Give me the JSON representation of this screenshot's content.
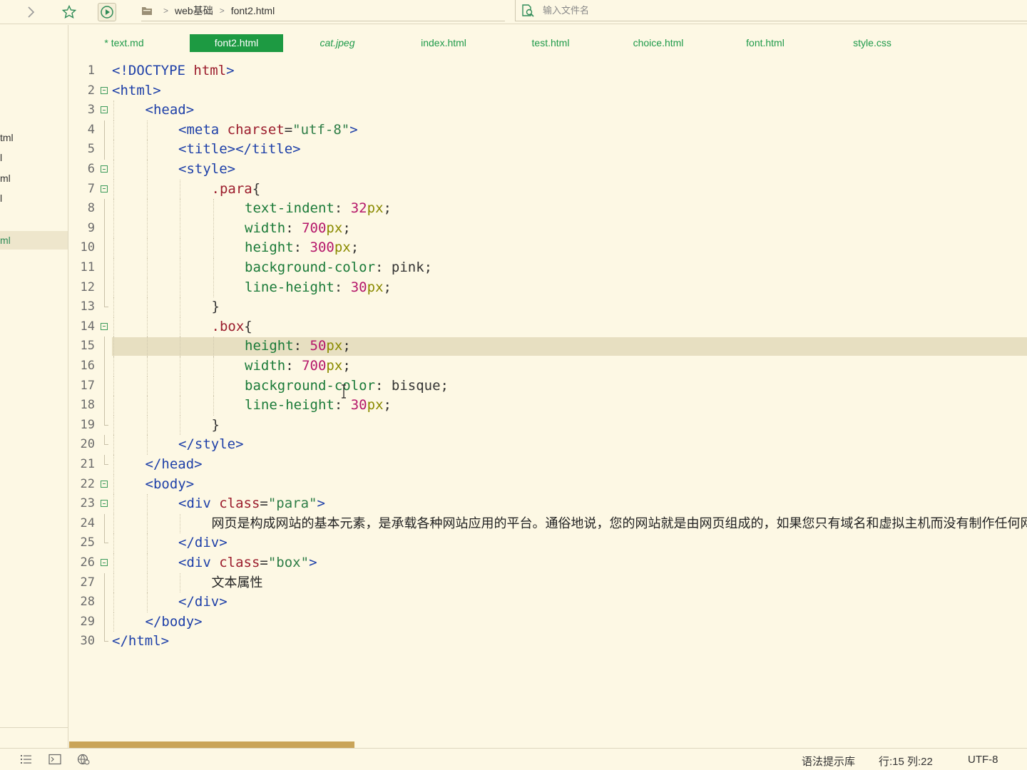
{
  "toolbar": {
    "breadcrumb": [
      "web基础",
      "font2.html"
    ],
    "search_placeholder": "输入文件名"
  },
  "sidebar": {
    "items": [
      {
        "label": "tml",
        "active": false
      },
      {
        "label": "l",
        "active": false
      },
      {
        "label": "ml",
        "active": false
      },
      {
        "label": "l",
        "active": false
      },
      {
        "label": "ml",
        "active": true
      }
    ]
  },
  "tabs": [
    {
      "label": "* text.md",
      "active": false,
      "italic": false
    },
    {
      "label": "font2.html",
      "active": true,
      "italic": false
    },
    {
      "label": "cat.jpeg",
      "active": false,
      "italic": true
    },
    {
      "label": "index.html",
      "active": false,
      "italic": false
    },
    {
      "label": "test.html",
      "active": false,
      "italic": false
    },
    {
      "label": "choice.html",
      "active": false,
      "italic": false
    },
    {
      "label": "font.html",
      "active": false,
      "italic": false
    },
    {
      "label": "style.css",
      "active": false,
      "italic": false
    }
  ],
  "editor": {
    "current_line": 15,
    "lines": [
      {
        "n": "1",
        "fold": "",
        "indent": 0,
        "tokens": [
          [
            "tag",
            "<!DOCTYPE "
          ],
          [
            "attr",
            "html"
          ],
          [
            "tag",
            ">"
          ]
        ]
      },
      {
        "n": "2",
        "fold": "open",
        "indent": 0,
        "tokens": [
          [
            "tag",
            "<html>"
          ]
        ]
      },
      {
        "n": "3",
        "fold": "open",
        "indent": 1,
        "tokens": [
          [
            "tag",
            "<head>"
          ]
        ]
      },
      {
        "n": "4",
        "fold": "line",
        "indent": 2,
        "tokens": [
          [
            "tag",
            "<meta "
          ],
          [
            "attr",
            "charset"
          ],
          [
            "plain",
            "="
          ],
          [
            "str",
            "\"utf-8\""
          ],
          [
            "tag",
            ">"
          ]
        ]
      },
      {
        "n": "5",
        "fold": "line",
        "indent": 2,
        "tokens": [
          [
            "tag",
            "<title></title>"
          ]
        ]
      },
      {
        "n": "6",
        "fold": "open",
        "indent": 2,
        "tokens": [
          [
            "tag",
            "<style>"
          ]
        ]
      },
      {
        "n": "7",
        "fold": "open",
        "indent": 3,
        "tokens": [
          [
            "sel",
            ".para"
          ],
          [
            "plain",
            "{"
          ]
        ]
      },
      {
        "n": "8",
        "fold": "line",
        "indent": 4,
        "tokens": [
          [
            "prop",
            "text-indent"
          ],
          [
            "plain",
            ": "
          ],
          [
            "num",
            "32"
          ],
          [
            "unit",
            "px"
          ],
          [
            "plain",
            ";"
          ]
        ]
      },
      {
        "n": "9",
        "fold": "line",
        "indent": 4,
        "tokens": [
          [
            "prop",
            "width"
          ],
          [
            "plain",
            ": "
          ],
          [
            "num",
            "700"
          ],
          [
            "unit",
            "px"
          ],
          [
            "plain",
            ";"
          ]
        ]
      },
      {
        "n": "10",
        "fold": "line",
        "indent": 4,
        "tokens": [
          [
            "prop",
            "height"
          ],
          [
            "plain",
            ": "
          ],
          [
            "num",
            "300"
          ],
          [
            "unit",
            "px"
          ],
          [
            "plain",
            ";"
          ]
        ]
      },
      {
        "n": "11",
        "fold": "line",
        "indent": 4,
        "tokens": [
          [
            "prop",
            "background-color"
          ],
          [
            "plain",
            ": pink;"
          ]
        ]
      },
      {
        "n": "12",
        "fold": "line",
        "indent": 4,
        "tokens": [
          [
            "prop",
            "line-height"
          ],
          [
            "plain",
            ": "
          ],
          [
            "num",
            "30"
          ],
          [
            "unit",
            "px"
          ],
          [
            "plain",
            ";"
          ]
        ]
      },
      {
        "n": "13",
        "fold": "end",
        "indent": 3,
        "tokens": [
          [
            "plain",
            "}"
          ]
        ]
      },
      {
        "n": "14",
        "fold": "open",
        "indent": 3,
        "tokens": [
          [
            "sel",
            ".box"
          ],
          [
            "plain",
            "{"
          ]
        ]
      },
      {
        "n": "15",
        "fold": "line",
        "indent": 4,
        "tokens": [
          [
            "prop",
            "height"
          ],
          [
            "plain",
            ": "
          ],
          [
            "num",
            "50"
          ],
          [
            "unit",
            "px"
          ],
          [
            "plain",
            ";"
          ]
        ]
      },
      {
        "n": "16",
        "fold": "line",
        "indent": 4,
        "tokens": [
          [
            "prop",
            "width"
          ],
          [
            "plain",
            ": "
          ],
          [
            "num",
            "700"
          ],
          [
            "unit",
            "px"
          ],
          [
            "plain",
            ";"
          ]
        ]
      },
      {
        "n": "17",
        "fold": "line",
        "indent": 4,
        "tokens": [
          [
            "prop",
            "background-color"
          ],
          [
            "plain",
            ": bisque;"
          ]
        ]
      },
      {
        "n": "18",
        "fold": "line",
        "indent": 4,
        "tokens": [
          [
            "prop",
            "line-height"
          ],
          [
            "plain",
            ": "
          ],
          [
            "num",
            "30"
          ],
          [
            "unit",
            "px"
          ],
          [
            "plain",
            ";"
          ]
        ]
      },
      {
        "n": "19",
        "fold": "end",
        "indent": 3,
        "tokens": [
          [
            "plain",
            "}"
          ]
        ]
      },
      {
        "n": "20",
        "fold": "end",
        "indent": 2,
        "tokens": [
          [
            "tag",
            "</style>"
          ]
        ]
      },
      {
        "n": "21",
        "fold": "end",
        "indent": 1,
        "tokens": [
          [
            "tag",
            "</head>"
          ]
        ]
      },
      {
        "n": "22",
        "fold": "open",
        "indent": 1,
        "tokens": [
          [
            "tag",
            "<body>"
          ]
        ]
      },
      {
        "n": "23",
        "fold": "open",
        "indent": 2,
        "tokens": [
          [
            "tag",
            "<div "
          ],
          [
            "attr",
            "class"
          ],
          [
            "plain",
            "="
          ],
          [
            "str",
            "\"para\""
          ],
          [
            "tag",
            ">"
          ]
        ]
      },
      {
        "n": "24",
        "fold": "line",
        "indent": 3,
        "tokens": [
          [
            "cjk",
            "网页是构成网站的基本元素，是承载各种网站应用的平台。通俗地说，您的网站就是由网页组成的，如果您只有域名和虚拟主机而没有制作任何网页的话"
          ]
        ]
      },
      {
        "n": "25",
        "fold": "end",
        "indent": 2,
        "tokens": [
          [
            "tag",
            "</div>"
          ]
        ]
      },
      {
        "n": "26",
        "fold": "open",
        "indent": 2,
        "tokens": [
          [
            "tag",
            "<div "
          ],
          [
            "attr",
            "class"
          ],
          [
            "plain",
            "="
          ],
          [
            "str",
            "\"box\""
          ],
          [
            "tag",
            ">"
          ]
        ]
      },
      {
        "n": "27",
        "fold": "line",
        "indent": 3,
        "tokens": [
          [
            "cjk",
            "文本属性"
          ]
        ]
      },
      {
        "n": "28",
        "fold": "line",
        "indent": 2,
        "tokens": [
          [
            "tag",
            "</div>"
          ]
        ]
      },
      {
        "n": "29",
        "fold": "line",
        "indent": 1,
        "tokens": [
          [
            "tag",
            "</body>"
          ]
        ]
      },
      {
        "n": "30",
        "fold": "end",
        "indent": 0,
        "tokens": [
          [
            "tag",
            "</html>"
          ]
        ]
      }
    ]
  },
  "statusbar": {
    "syntax_lib": "语法提示库",
    "position": "行:15  列:22",
    "encoding": "UTF-8"
  }
}
